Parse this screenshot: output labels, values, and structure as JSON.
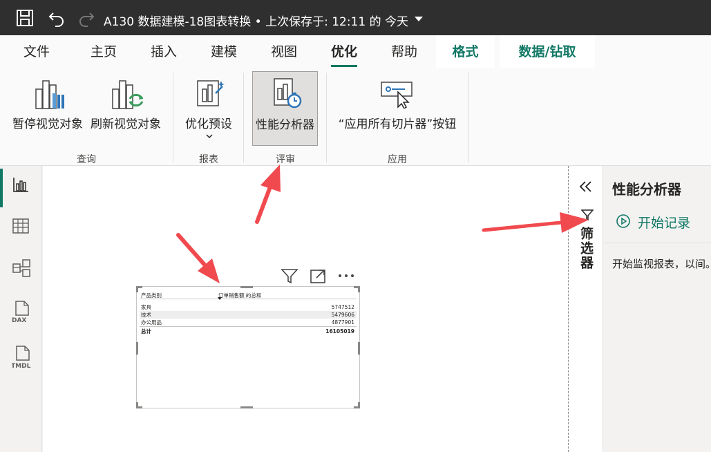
{
  "titlebar": {
    "title": "A130 数据建模-18图表转换 • 上次保存于: 12:11 的 今天",
    "icons": [
      "save-icon",
      "undo-icon",
      "redo-icon",
      "dropdown-caret-icon"
    ]
  },
  "tabs": [
    {
      "label": "文件"
    },
    {
      "label": "主页"
    },
    {
      "label": "插入"
    },
    {
      "label": "建模"
    },
    {
      "label": "视图"
    },
    {
      "label": "优化",
      "active": true
    },
    {
      "label": "帮助"
    },
    {
      "label": "格式",
      "context": true
    },
    {
      "label": "数据/钻取",
      "context": true
    }
  ],
  "ribbon": {
    "pause_visuals": "暂停视觉对象",
    "refresh_visuals": "刷新视觉对象",
    "optimize_presets": "优化预设",
    "performance_analyzer": "性能分析器",
    "apply_all_slicers": "“应用所有切片器”按钮",
    "groups": {
      "query": "查询",
      "report": "报表",
      "review": "评审",
      "apply": "应用"
    }
  },
  "leftnav": [
    "report-view-icon",
    "table-view-icon",
    "model-view-icon",
    "dax-query-view-icon",
    "tmdl-view-icon"
  ],
  "visual": {
    "columns": [
      "产品类别",
      "订单销售额 的总和"
    ],
    "rows": [
      {
        "category": "家具",
        "value": "5747512"
      },
      {
        "category": "技术",
        "value": "5479606"
      },
      {
        "category": "办公用品",
        "value": "4877901"
      }
    ],
    "total": {
      "category": "总计",
      "value": "16105019"
    }
  },
  "filter_pane": {
    "label": "筛选器"
  },
  "perf_pane": {
    "title": "性能分析器",
    "start_label": "开始记录",
    "description": "开始监视报表，以间。"
  },
  "colors": {
    "accent": "#117865",
    "arrow": "#f04a4f",
    "titlebar": "#2f2f2f"
  }
}
